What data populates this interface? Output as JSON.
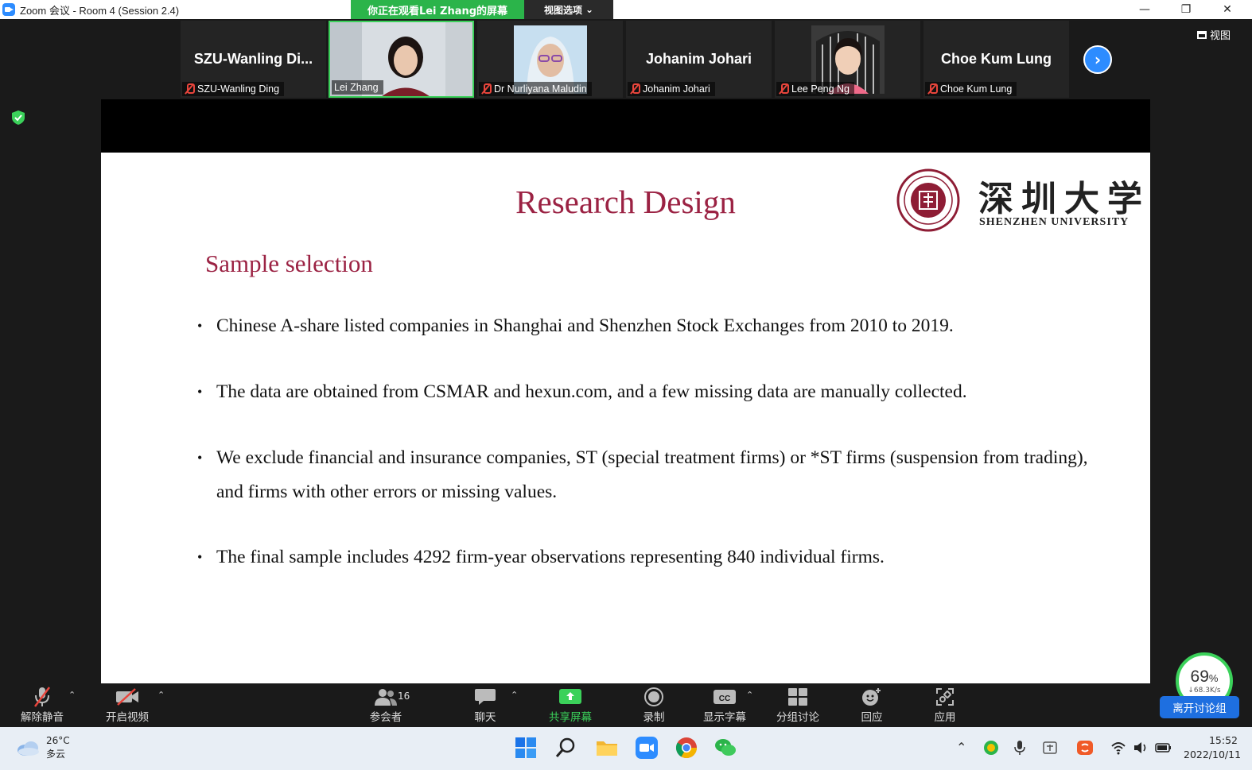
{
  "window": {
    "title": "Zoom 会议 - Room 4 (Session 2.4)",
    "share_banner": "你正在观看Lei Zhang的屏幕",
    "view_options": "视图选项"
  },
  "gallery": {
    "participants": [
      {
        "big_name": "SZU-Wanling  Di...",
        "label": "SZU-Wanling Ding"
      },
      {
        "big_name": "",
        "label": "Lei Zhang"
      },
      {
        "big_name": "",
        "label": "Dr Nurliyana Maludin"
      },
      {
        "big_name": "Johanim Johari",
        "label": "Johanim Johari"
      },
      {
        "big_name": "",
        "label": "Lee Peng Ng"
      },
      {
        "big_name": "Choe Kum Lung",
        "label": "Choe Kum Lung"
      }
    ],
    "view_label": "视图"
  },
  "slide": {
    "title": "Research Design",
    "university_cn": "深圳大学",
    "university_en": "SHENZHEN UNIVERSITY",
    "section": "Sample selection",
    "bullets": [
      "Chinese A-share listed companies in Shanghai and Shenzhen Stock Exchanges from 2010 to 2019.",
      "The data are obtained from CSMAR and hexun.com, and a few missing data are manually collected.",
      "We exclude financial and insurance companies, ST (special treatment firms) or *ST firms (suspension from trading), and firms with other errors or missing values.",
      "The final sample includes 4292 firm-year observations representing 840 individual firms."
    ]
  },
  "toolbar": {
    "unmute": "解除静音",
    "start_video": "开启视频",
    "participants": "参会者",
    "participants_count": "16",
    "chat": "聊天",
    "share_screen": "共享屏幕",
    "record": "录制",
    "captions": "显示字幕",
    "breakout": "分组讨论",
    "reactions": "回应",
    "apps": "应用",
    "leave_breakout": "离开讨论组"
  },
  "network": {
    "percent": "69",
    "percent_sign": "%",
    "speed": "↓68.3K/s"
  },
  "taskbar": {
    "temperature": "26°C",
    "weather": "多云",
    "time": "15:52",
    "date": "2022/10/11"
  },
  "colors": {
    "zoom_blue": "#2d8cff",
    "share_green": "#3bd15a",
    "slide_title": "#9b2243",
    "mic_red": "#e8453c"
  }
}
